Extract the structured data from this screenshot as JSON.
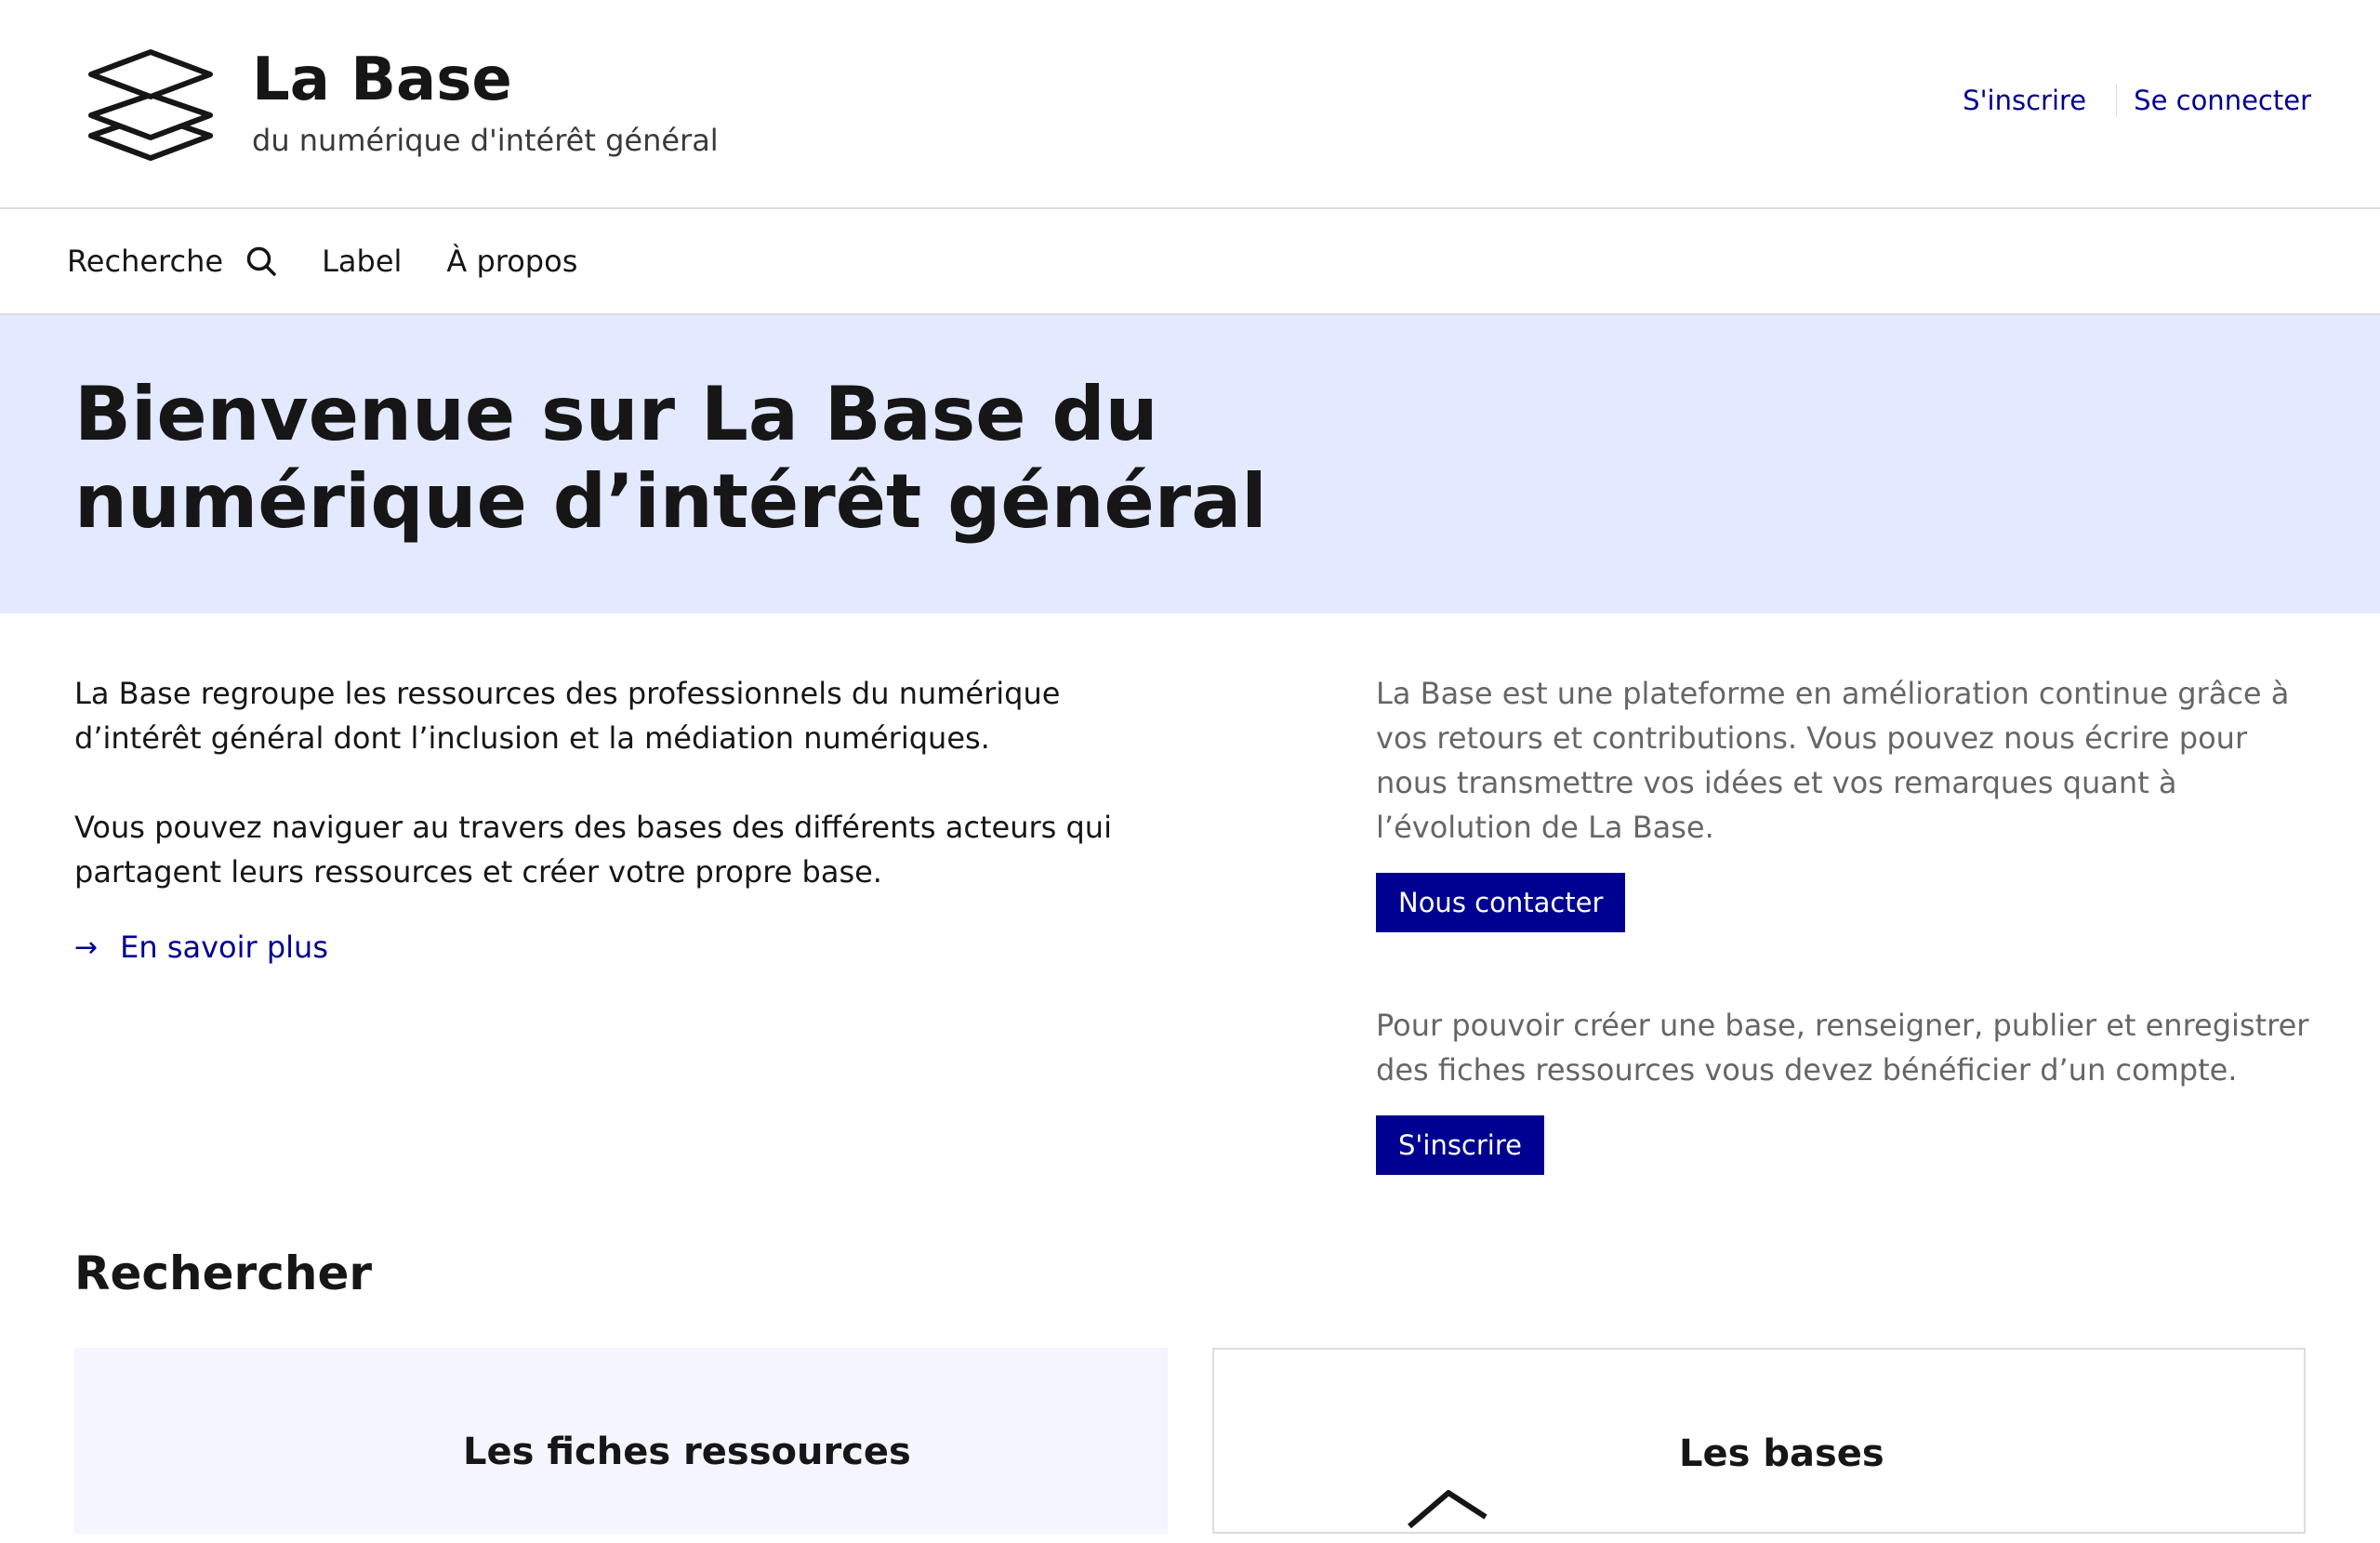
{
  "header": {
    "brand_title": "La Base",
    "brand_tagline": "du numérique d'intérêt général",
    "signup_link": "S'inscrire",
    "login_link": "Se connecter"
  },
  "nav": {
    "items": [
      {
        "label": "Recherche",
        "icon": "search-icon"
      },
      {
        "label": "Label"
      },
      {
        "label": "À propos"
      }
    ]
  },
  "hero": {
    "title": "Bienvenue sur La Base du numérique d’intérêt général"
  },
  "intro": {
    "paragraph_1": "La Base regroupe les ressources des professionnels du numérique d’intérêt général dont l’inclusion et la médiation numériques.",
    "paragraph_2": "Vous pouvez naviguer au travers des bases des différents acteurs qui partagent leurs ressources et créer votre propre base.",
    "learn_more": "En savoir plus"
  },
  "side": {
    "feedback_text": "La Base est une plateforme en amélioration continue grâce à vos retours et contributions. Vous pouvez nous écrire pour nous transmettre vos idées et vos remarques quant à l’évolution de La Base.",
    "contact_button": "Nous contacter",
    "account_text": "Pour pouvoir créer une base, renseigner, publier et enregistrer des fiches ressources vous devez bénéficier d’un compte.",
    "signup_button": "S'inscrire"
  },
  "search_section": {
    "title": "Rechercher",
    "cards": [
      {
        "title": "Les fiches ressources"
      },
      {
        "title": "Les bases"
      }
    ]
  },
  "colors": {
    "primary": "#000091",
    "hero_background": "#e3e9ff",
    "card_background": "#f4f5ff",
    "text": "#161616",
    "muted_text": "#666666"
  }
}
